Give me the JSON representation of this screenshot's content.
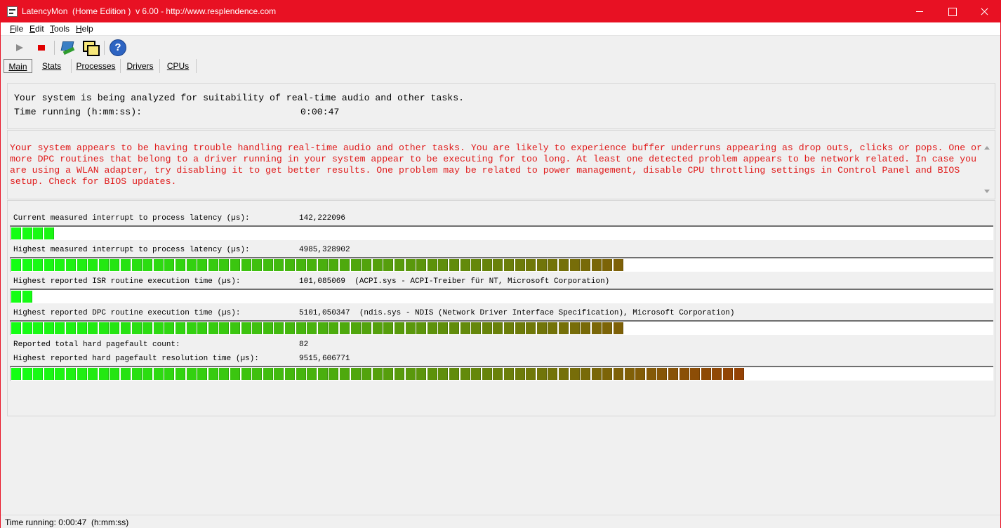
{
  "window": {
    "title": "LatencyMon  (Home Edition )  v 6.00 - http://www.resplendence.com"
  },
  "menu": [
    {
      "acc": "F",
      "rest": "ile"
    },
    {
      "acc": "E",
      "rest": "dit"
    },
    {
      "acc": "T",
      "rest": "ools"
    },
    {
      "acc": "H",
      "rest": "elp"
    }
  ],
  "toolbar": {
    "start_icon": "play-icon",
    "stop_icon": "stop-icon",
    "tool_icon": "driver-tool-icon",
    "window_icon": "windows-icon",
    "help_icon": "help-icon"
  },
  "tabs": [
    {
      "label": "Main",
      "active": true
    },
    {
      "label": "Stats",
      "active": false
    },
    {
      "label": "Processes",
      "active": false
    },
    {
      "label": "Drivers",
      "active": false
    },
    {
      "label": "CPUs",
      "active": false
    }
  ],
  "main": {
    "analyzing": "Your system is being analyzed for suitability of real-time audio and other tasks.",
    "time_label": "Time running (h:mm:ss):",
    "time_value": "0:00:47",
    "warning": "Your system appears to be having trouble handling real-time audio and other tasks. You are likely to experience buffer underruns appearing as drop outs, clicks or pops. One or more DPC routines that belong to a driver running in your system appear to be executing for too long. At least one detected problem appears to be network related. In case you are using a WLAN adapter, try disabling it to get better results. One problem may be related to power management, disable CPU throttling settings in Control Panel and BIOS setup. Check for BIOS updates.",
    "warning_color": "#e01a1a",
    "metrics": [
      {
        "label": "Current measured interrupt to process latency (µs):",
        "value": "142,222096",
        "level_segments": 4,
        "total_segments": 90
      },
      {
        "label": "Highest measured interrupt to process latency (µs):",
        "value": "4985,328902",
        "level_segments": 56,
        "total_segments": 90
      },
      {
        "label": "Highest reported ISR routine execution time (µs):",
        "value": "101,085069  (ACPI.sys - ACPI-Treiber für NT, Microsoft Corporation)",
        "level_segments": 2,
        "total_segments": 90
      },
      {
        "label": "Highest reported DPC routine execution time (µs):",
        "value": "5101,050347  (ndis.sys - NDIS (Network Driver Interface Specification), Microsoft Corporation)",
        "level_segments": 56,
        "total_segments": 90
      },
      {
        "label": "Reported total hard pagefault count:",
        "value": "82",
        "level_segments": null,
        "total_segments": null
      },
      {
        "label": "Highest reported hard pagefault resolution time (µs):",
        "value": "9515,606771",
        "level_segments": 67,
        "total_segments": 90
      }
    ]
  },
  "status": {
    "text": "Time running: 0:00:47  (h:mm:ss)"
  },
  "colors": {
    "titlebar": "#e81123",
    "meter_low": "#14ff14",
    "meter_high": "#c00000"
  }
}
